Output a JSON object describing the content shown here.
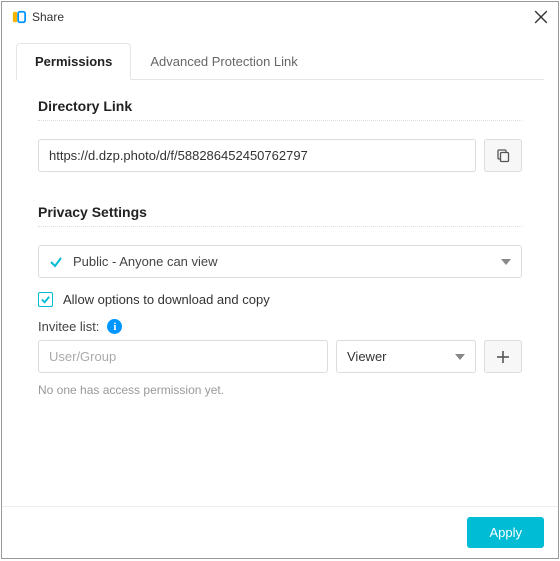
{
  "window": {
    "title": "Share"
  },
  "tabs": {
    "permissions": "Permissions",
    "advanced": "Advanced Protection Link"
  },
  "directory": {
    "title": "Directory Link",
    "url": "https://d.dzp.photo/d/f/588286452450762797"
  },
  "privacy": {
    "title": "Privacy Settings",
    "selected": "Public - Anyone can view",
    "allow_download_label": "Allow options to download and copy",
    "allow_download_checked": true,
    "invitee_label": "Invitee list:",
    "invitee_placeholder": "User/Group",
    "role_selected": "Viewer",
    "empty_text": "No one has access permission yet."
  },
  "footer": {
    "apply": "Apply"
  },
  "colors": {
    "accent": "#00bcd4"
  }
}
